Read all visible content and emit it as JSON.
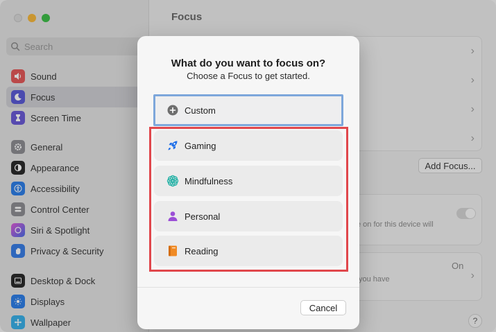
{
  "sidebar": {
    "search_placeholder": "Search",
    "groups": [
      [
        {
          "label": "Sound",
          "icon": "speaker-icon",
          "color": "#e35a5a"
        },
        {
          "label": "Focus",
          "icon": "moon-icon",
          "color": "#5b5bd6",
          "selected": true
        },
        {
          "label": "Screen Time",
          "icon": "hourglass-icon",
          "color": "#6b5bd6"
        }
      ],
      [
        {
          "label": "General",
          "icon": "gear-icon",
          "color": "#8e8e93"
        },
        {
          "label": "Appearance",
          "icon": "appearance-icon",
          "color": "#2b2b2b"
        },
        {
          "label": "Accessibility",
          "icon": "accessibility-icon",
          "color": "#2f7fe8"
        },
        {
          "label": "Control Center",
          "icon": "control-center-icon",
          "color": "#8e8e93"
        },
        {
          "label": "Siri & Spotlight",
          "icon": "siri-icon",
          "color": "#b05ad8"
        },
        {
          "label": "Privacy & Security",
          "icon": "hand-icon",
          "color": "#3a7ee6"
        }
      ],
      [
        {
          "label": "Desktop & Dock",
          "icon": "dock-icon",
          "color": "#2b2b2b"
        },
        {
          "label": "Displays",
          "icon": "sun-icon",
          "color": "#2f7fe8"
        },
        {
          "label": "Wallpaper",
          "icon": "wallpaper-icon",
          "color": "#3ab0e8"
        }
      ]
    ]
  },
  "main": {
    "title": "Focus",
    "add_focus_label": "Add Focus...",
    "share_text": "e on for this device will",
    "status_text": "On",
    "status_sub": "you have",
    "help_label": "?"
  },
  "modal": {
    "title": "What do you want to focus on?",
    "subtitle": "Choose a Focus to get started.",
    "custom_option": {
      "label": "Custom",
      "icon": "plus-circle-icon"
    },
    "options": [
      {
        "label": "Gaming",
        "icon": "rocket-icon",
        "color": "#1f6fe8"
      },
      {
        "label": "Mindfulness",
        "icon": "flower-icon",
        "color": "#2bb3a8"
      },
      {
        "label": "Personal",
        "icon": "person-icon",
        "color": "#9b4fd6"
      },
      {
        "label": "Reading",
        "icon": "book-icon",
        "color": "#f08a24"
      }
    ],
    "cancel_label": "Cancel"
  }
}
